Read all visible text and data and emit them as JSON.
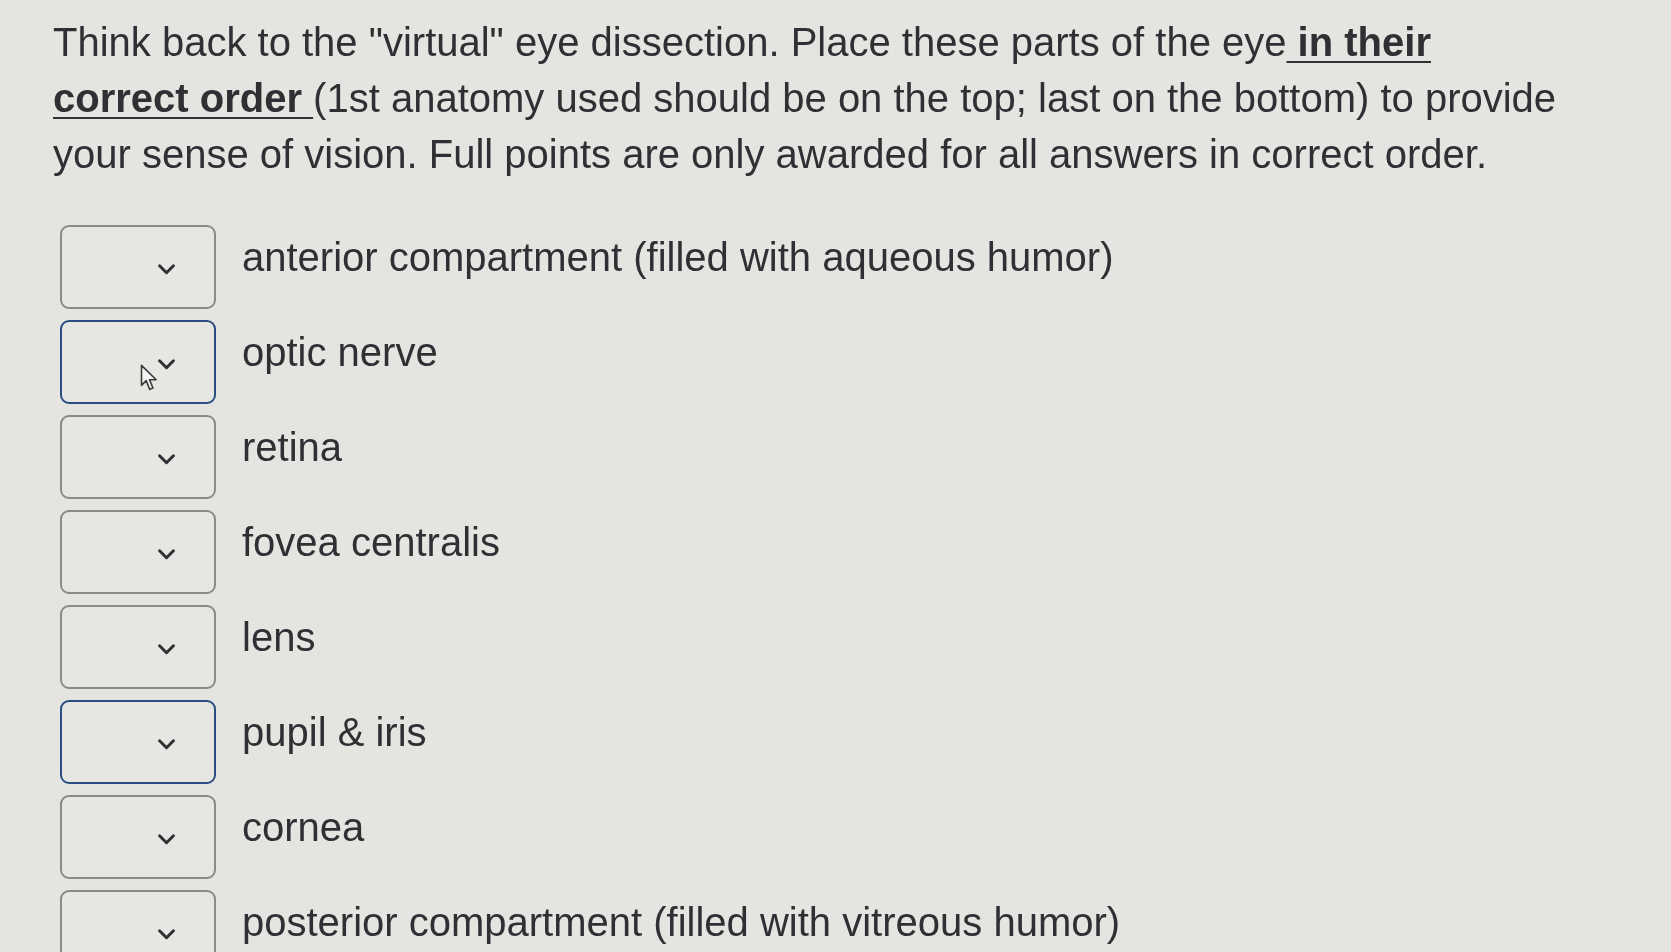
{
  "question": {
    "segments": [
      {
        "kind": "plain",
        "text": "Think back to the \"virtual\" eye dissection. Place these parts of the eye"
      },
      {
        "kind": "emphasis",
        "text": " in their correct order "
      },
      {
        "kind": "plain",
        "text": "(1st anatomy used should be on the top; last on the bottom) to provide your sense of vision. Full points are only awarded for all answers in correct order."
      }
    ]
  },
  "answers": [
    {
      "label": "anterior compartment (filled with aqueous humor)",
      "focused": false,
      "hovered": false
    },
    {
      "label": "optic nerve",
      "focused": true,
      "hovered": true
    },
    {
      "label": "retina",
      "focused": false,
      "hovered": false
    },
    {
      "label": "fovea centralis",
      "focused": false,
      "hovered": false
    },
    {
      "label": "lens",
      "focused": false,
      "hovered": false
    },
    {
      "label": "pupil & iris",
      "focused": true,
      "hovered": false
    },
    {
      "label": "cornea",
      "focused": false,
      "hovered": false
    },
    {
      "label": "posterior compartment (filled with vitreous humor)",
      "focused": false,
      "hovered": false
    }
  ]
}
